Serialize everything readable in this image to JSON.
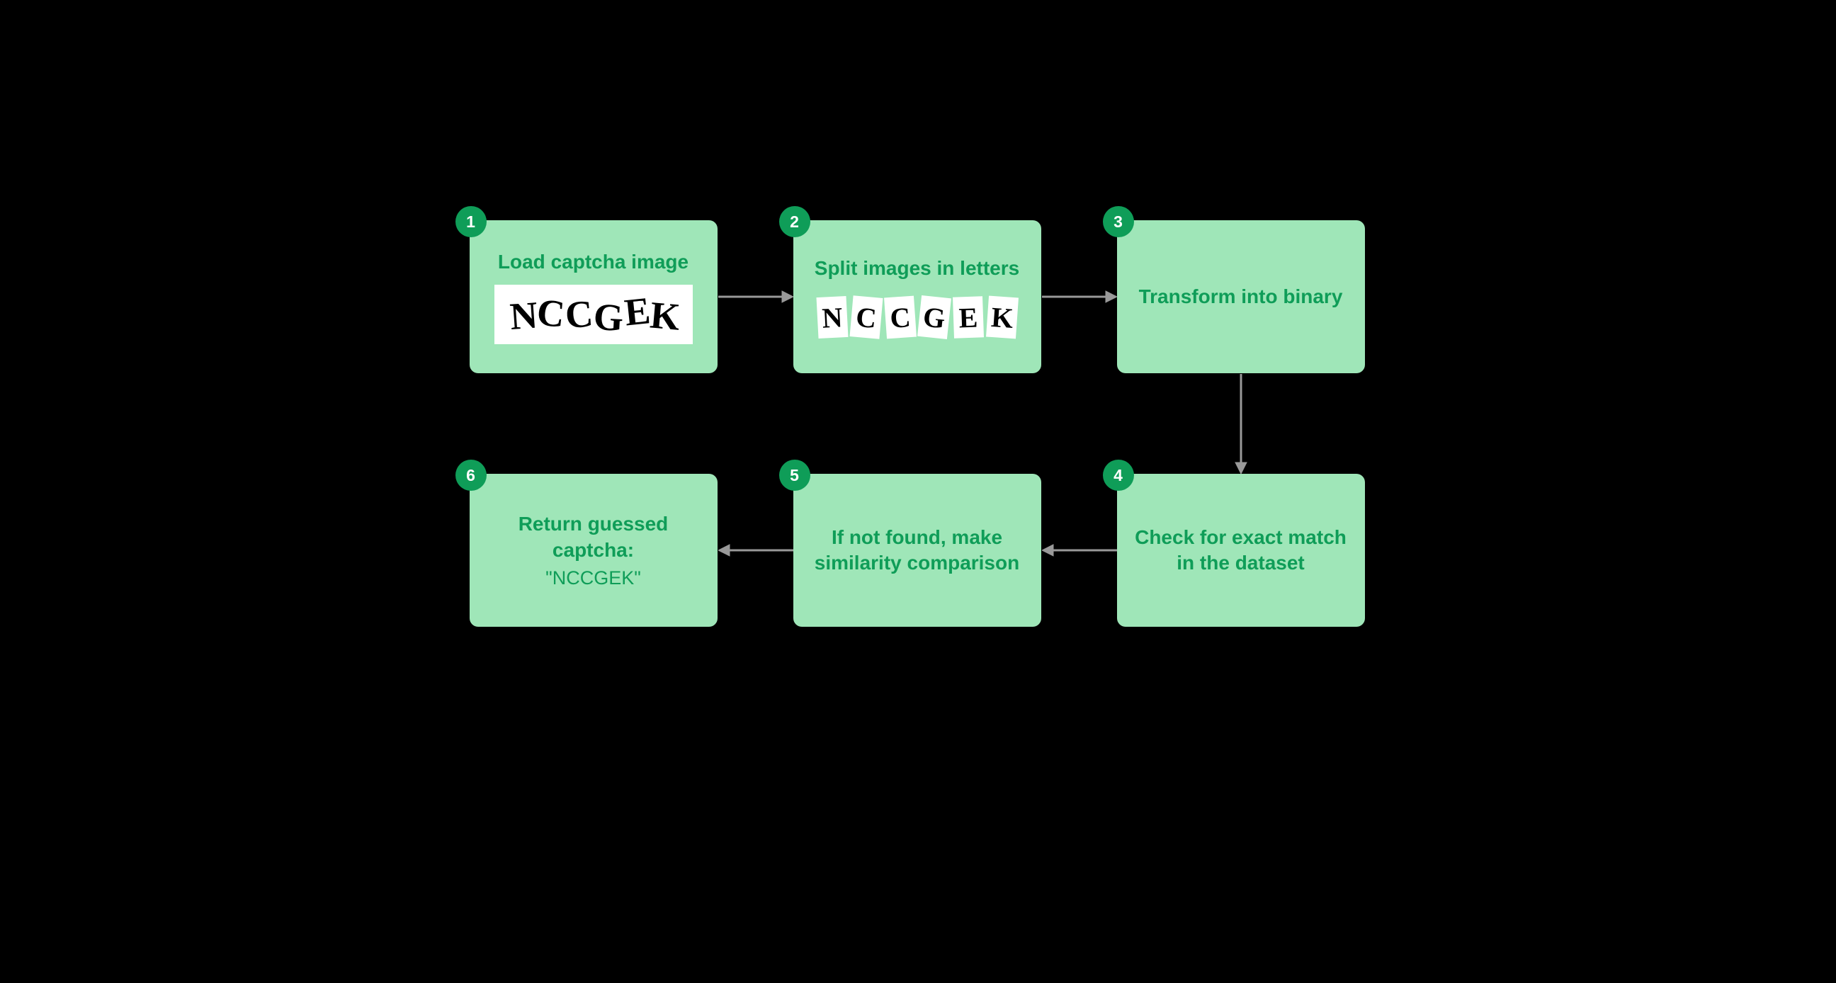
{
  "steps": {
    "s1": {
      "num": "1",
      "title": "Load captcha image"
    },
    "s2": {
      "num": "2",
      "title": "Split images in letters"
    },
    "s3": {
      "num": "3",
      "title": "Transform into binary"
    },
    "s4": {
      "num": "4",
      "title": "Check for exact match in the dataset"
    },
    "s5": {
      "num": "5",
      "title": "If not found, make similarity comparison"
    },
    "s6": {
      "num": "6",
      "title": "Return guessed captcha:",
      "result": "\"NCCGEK\""
    }
  },
  "captcha_letters": [
    "N",
    "C",
    "C",
    "G",
    "E",
    "K"
  ]
}
